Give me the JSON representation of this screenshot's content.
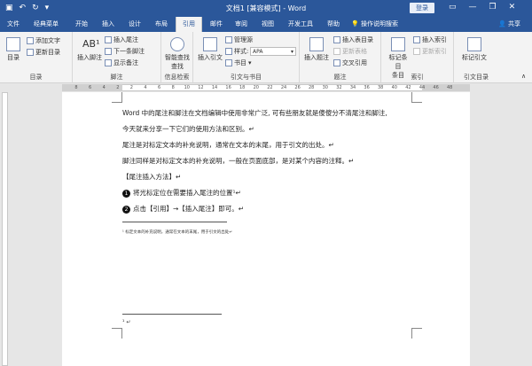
{
  "titlebar": {
    "title": "文档1 [兼容模式] - Word",
    "login": "登录",
    "qat_icons": [
      "save-icon",
      "undo-icon",
      "redo-icon",
      "customize-icon"
    ]
  },
  "tabs": [
    "文件",
    "经典菜单",
    "开始",
    "插入",
    "设计",
    "布局",
    "引用",
    "邮件",
    "审阅",
    "视图",
    "开发工具",
    "帮助",
    "操作说明搜索"
  ],
  "active_tab": "引用",
  "share": "共享",
  "ribbon": {
    "toc": {
      "big": "目录",
      "add_text": "添加文字",
      "update": "更新目录",
      "label": "目录"
    },
    "footnotes": {
      "insert_footnote": "插入脚注",
      "insert_endnote": "插入尾注",
      "next_footnote": "下一条脚注",
      "show_notes": "显示备注",
      "label": "脚注"
    },
    "research": {
      "smart_lookup": "智能查找",
      "smart_lookup2": "查找",
      "label": "信息检索"
    },
    "citations": {
      "insert_citation": "插入引文",
      "manage_sources": "管理源",
      "style_label": "样式:",
      "style_value": "APA",
      "bibliography": "书目",
      "label": "引文与书目"
    },
    "captions": {
      "insert_caption": "插入题注",
      "insert_tof": "插入表目录",
      "update_table": "更新表格",
      "cross_ref": "交叉引用",
      "label": "题注"
    },
    "index": {
      "mark_entry": "标记条目",
      "mark_entry2": "条目",
      "insert_index": "插入索引",
      "update_index": "更新索引",
      "label": "索引"
    },
    "toa": {
      "mark_citation": "标记引文",
      "label": "引文目录"
    }
  },
  "ruler_ticks": [
    "8",
    "6",
    "4",
    "2",
    "2",
    "4",
    "6",
    "8",
    "10",
    "12",
    "14",
    "16",
    "18",
    "20",
    "22",
    "24",
    "26",
    "28",
    "30",
    "32",
    "34",
    "36",
    "38",
    "40",
    "42",
    "44",
    "46",
    "48"
  ],
  "document": {
    "lines": [
      "Word 中的尾注和脚注在文档编辑中使用非常广泛, 可有些朋友就是傻傻分不清尾注和脚注,",
      "今天就来分享一下它们的使用方法和区别。↵",
      "尾注是对标定文本的补充说明，通常在文本的末尾，用于引文的出处。↵",
      "脚注同样是对标定文本的补充说明，一般在页面底部，是对某个内容的注释。↵",
      "【尾注插入方法】↵"
    ],
    "steps": [
      {
        "num": "1",
        "text": "将光标定位在需要插入尾注的位置¹↵"
      },
      {
        "num": "2",
        "text": "点击【引用】→【插入尾注】即可。↵"
      }
    ],
    "footnote_text": "¹ 标定文本的补充说明，通常在文本的末尾，用于引文的出处↵",
    "endnote_mark": "¹ ↵"
  }
}
